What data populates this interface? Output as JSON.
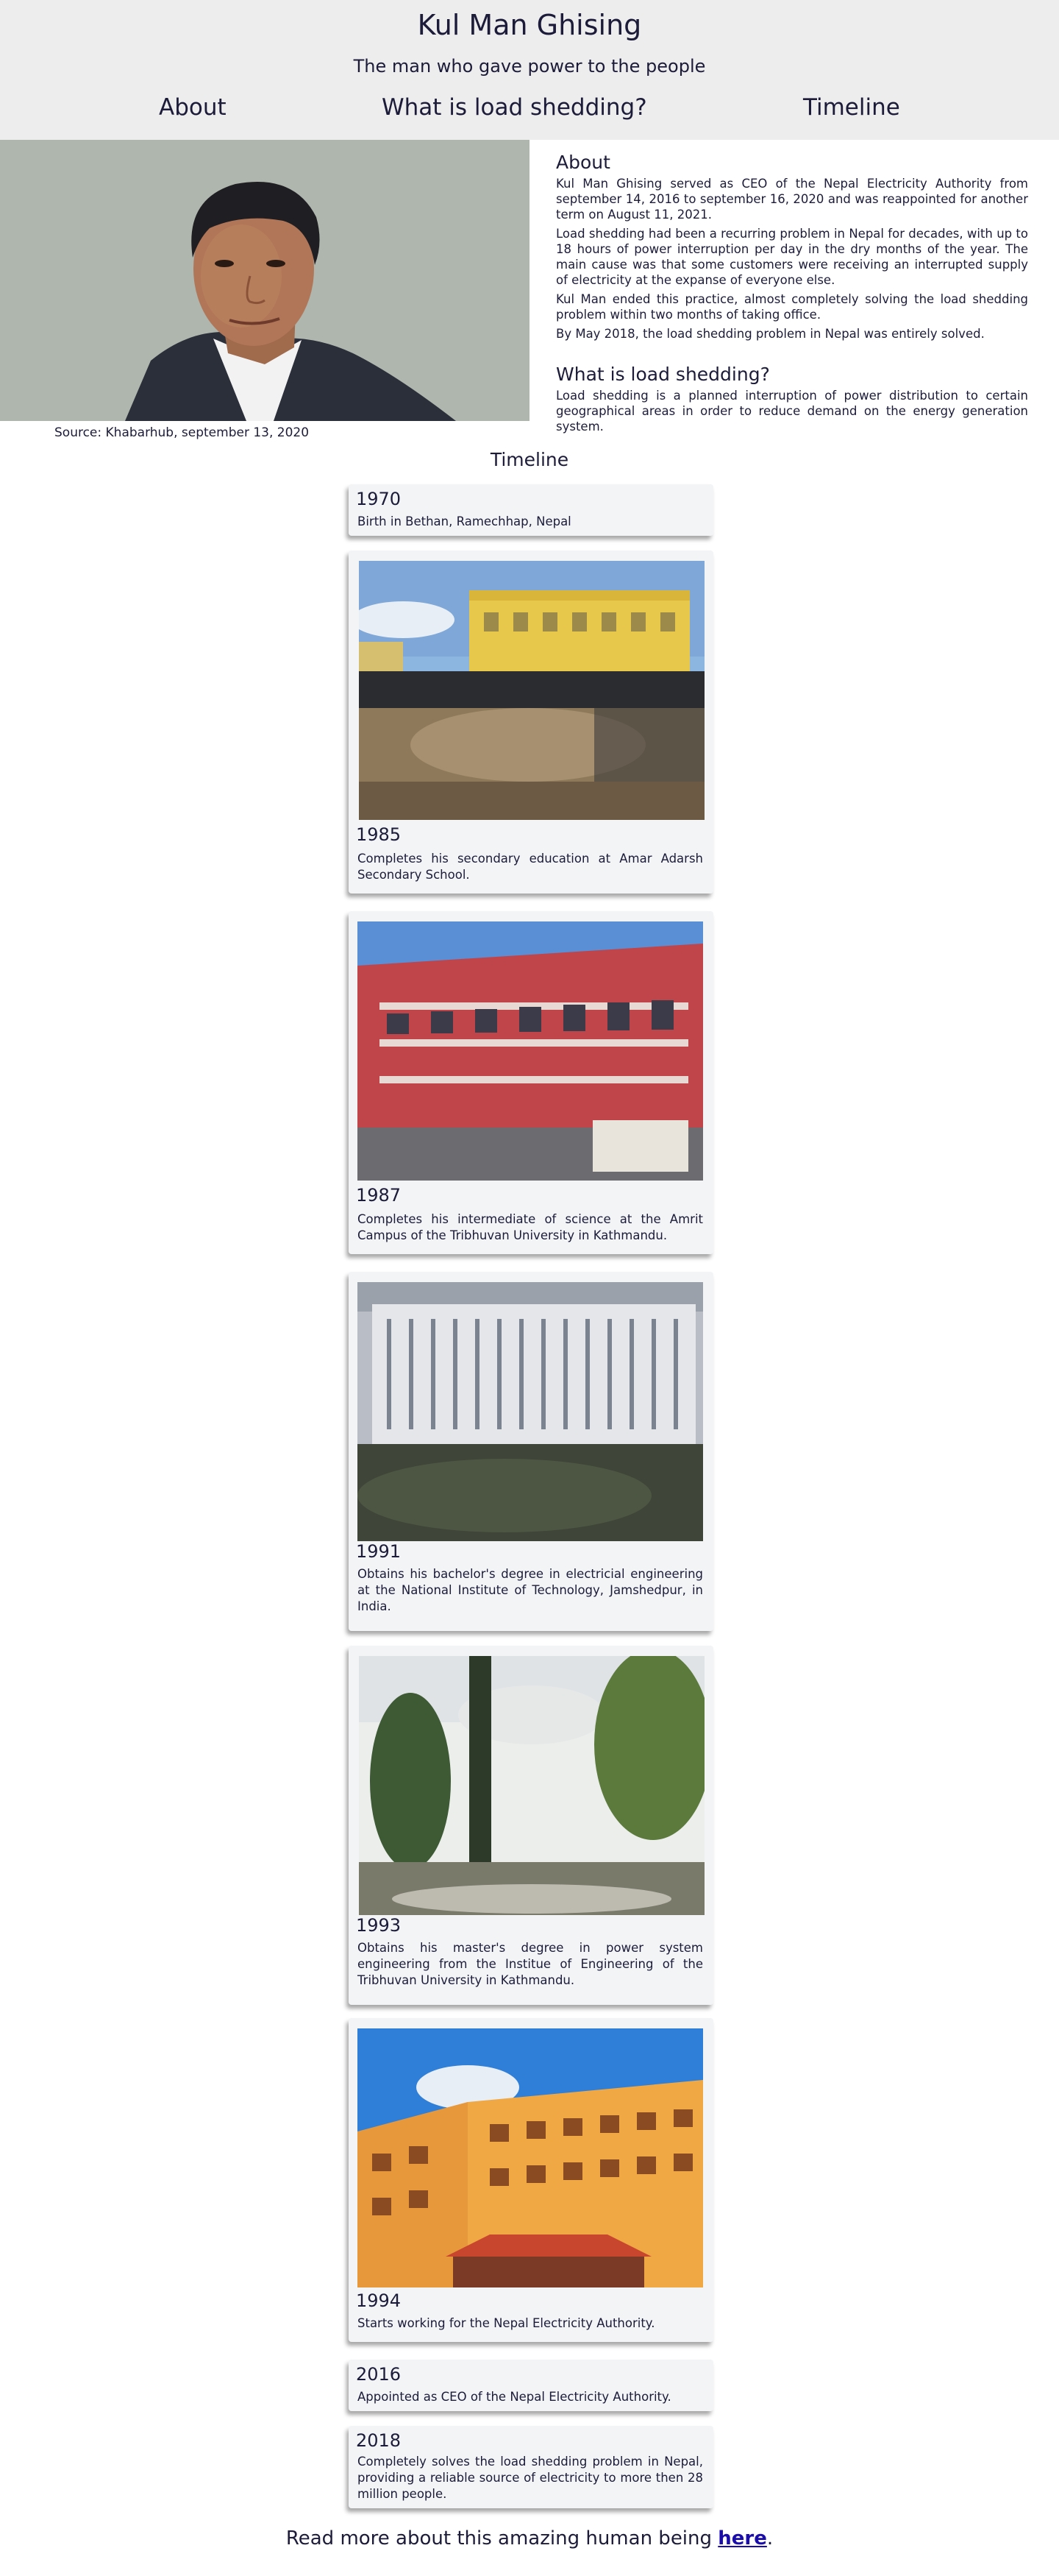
{
  "header": {
    "title": "Kul Man Ghising",
    "subtitle": "The man who gave power to the people",
    "nav": [
      "About",
      "What is load shedding?",
      "Timeline"
    ]
  },
  "portrait": {
    "caption": "Source: Khabarhub, september 13, 2020",
    "background_color": "#aeb6ae"
  },
  "about": {
    "heading": "About",
    "paragraphs": [
      "Kul Man Ghising served as CEO of the Nepal Electricity Authority from september 14, 2016 to september 16, 2020 and was reappointed for another term on August 11, 2021.",
      "Load shedding had been a recurring problem in Nepal for decades, with up to 18 hours of power interruption per day in the dry months of the year. The main cause was that some customers were receiving an interrupted supply of electricity at the expanse of everyone else.",
      "Kul Man ended this practice, almost completely solving the load shedding problem within two months of taking office.",
      "By May 2018, the load shedding problem in Nepal was entirely solved."
    ]
  },
  "load_shedding": {
    "heading": "What is load shedding?",
    "text": "Load shedding is a planned interruption of power distribution to certain geographical areas in order to reduce demand on the energy generation system."
  },
  "timeline": {
    "heading": "Timeline",
    "entries": [
      {
        "year": "1970",
        "text": "Birth in Bethan, Ramechhap, Nepal",
        "photo": "none"
      },
      {
        "year": "1985",
        "text": "Completes his secondary education at Amar Adarsh Secondary School.",
        "photo": "school-courtyard"
      },
      {
        "year": "1987",
        "text": "Completes his intermediate of science at the Amrit Campus of the Tribhuvan University in Kathmandu.",
        "photo": "red-campus-building"
      },
      {
        "year": "1991",
        "text": "Obtains his bachelor's degree in electricial engineering at the National Institute of Technology, Jamshedpur, in India.",
        "photo": "institute-aerial"
      },
      {
        "year": "1993",
        "text": "Obtains his master's degree in power system engineering from the Institue of Engineering of the Tribhuvan University in Kathmandu.",
        "photo": "white-palace-fountain"
      },
      {
        "year": "1994",
        "text": "Starts working for the Nepal Electricity Authority.",
        "photo": "orange-office-building"
      },
      {
        "year": "2016",
        "text": "Appointed as CEO of the Nepal Electricity Authority.",
        "photo": "none"
      },
      {
        "year": "2018",
        "text": "Completely solves the load shedding problem in Nepal, providing a reliable source of electricity to more then 28 million people.",
        "photo": "none"
      }
    ]
  },
  "footer": {
    "text": "Read more about this amazing human being",
    "link_text": "here",
    "after": ".",
    "link_color": "#1a0dab"
  }
}
